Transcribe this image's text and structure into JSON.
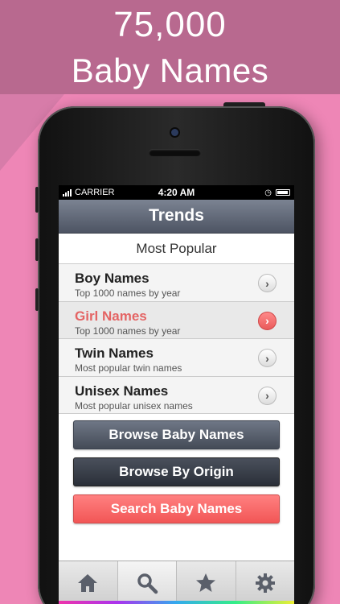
{
  "hero": {
    "line1": "75,000",
    "line2": "Baby Names"
  },
  "status_bar": {
    "carrier": "CARRIER",
    "time": "4:20 AM"
  },
  "nav": {
    "title": "Trends"
  },
  "section": {
    "title": "Most Popular"
  },
  "rows": [
    {
      "title": "Boy Names",
      "subtitle": "Top 1000 names by year",
      "selected": false
    },
    {
      "title": "Girl Names",
      "subtitle": "Top 1000 names by year",
      "selected": true
    },
    {
      "title": "Twin Names",
      "subtitle": "Most popular twin names",
      "selected": false
    },
    {
      "title": "Unisex Names",
      "subtitle": "Most popular unisex names",
      "selected": false
    }
  ],
  "actions": {
    "browse": "Browse Baby Names",
    "origin": "Browse By Origin",
    "search": "Search Baby Names"
  },
  "tabs": [
    {
      "icon": "home-icon",
      "active": false
    },
    {
      "icon": "search-icon",
      "active": true
    },
    {
      "icon": "star-icon",
      "active": false
    },
    {
      "icon": "gear-icon",
      "active": false
    }
  ],
  "colors": {
    "accent_red": "#e46464",
    "hero_bg": "#b8698f",
    "page_bg": "#ee86b6"
  }
}
